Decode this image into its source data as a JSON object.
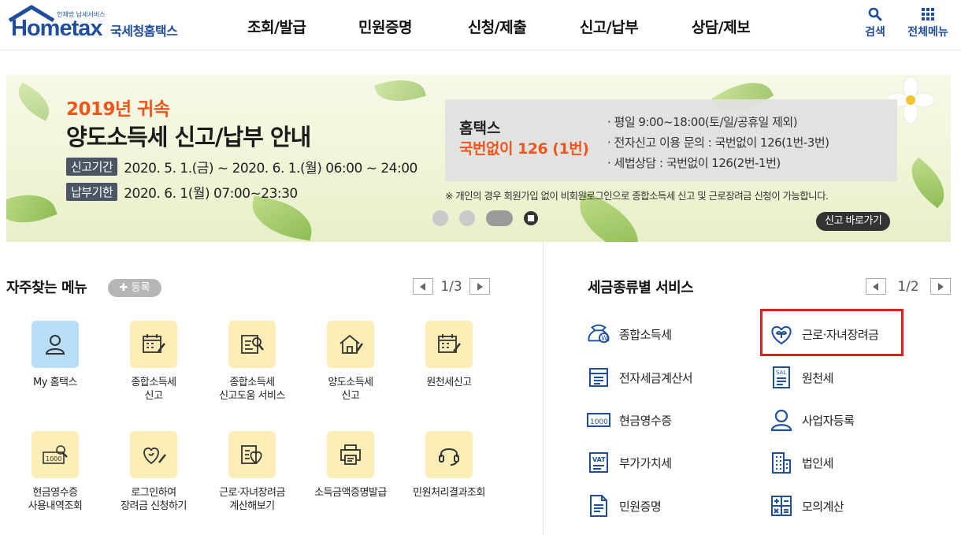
{
  "logo": {
    "small_text": "언제방 납세서비스",
    "brand": "Hometax",
    "brand_kr": "국세청홈택스"
  },
  "gnb": [
    "조회/발급",
    "민원증명",
    "신청/제출",
    "신고/납부",
    "상담/제보"
  ],
  "util": {
    "search": "검색",
    "all_menu": "전체메뉴"
  },
  "banner": {
    "title1": "2019년 귀속",
    "title2": "양도소득세 신고/납부 안내",
    "period1_tag": "신고기간",
    "period1": "2020. 5. 1.(금) ~ 2020. 6. 1.(월) 06:00 ~ 24:00",
    "period2_tag": "납부기한",
    "period2": "2020. 6. 1(월) 07:00~23:30",
    "box_title1": "홈택스",
    "box_title2": "국번없이 126 (1번)",
    "box_lines": [
      "· 평일 9:00~18:00(토/일/공휴일 제외)",
      "· 전자신고 이용 문의 : 국번없이 126(1번-3번)",
      "· 세법상담 : 국번없이 126(2번-1번)"
    ],
    "note": "※ 개인의 경우 회원가입 없이 비회원로그인으로 종합소득세 신고 및 근로장려금 신청이 가능합니다.",
    "button": "신고 바로가기"
  },
  "favorites": {
    "title": "자주찾는 메뉴",
    "add_label": "등록",
    "page": "1/3",
    "items": [
      {
        "label1": "My 홈택스",
        "label2": "",
        "icon": "user-icon"
      },
      {
        "label1": "종합소득세",
        "label2": "신고",
        "icon": "calendar-pen-icon"
      },
      {
        "label1": "종합소득세",
        "label2": "신고도움 서비스",
        "icon": "doc-search-icon"
      },
      {
        "label1": "양도소득세",
        "label2": "신고",
        "icon": "house-pen-icon"
      },
      {
        "label1": "원천세신고",
        "label2": "",
        "icon": "calendar-pen-icon"
      },
      {
        "label1": "현금영수증",
        "label2": "사용내역조회",
        "icon": "receipt-search-icon"
      },
      {
        "label1": "로그인하여",
        "label2": "장려금 신청하기",
        "icon": "heart-pen-icon"
      },
      {
        "label1": "근로·자녀장려금",
        "label2": "계산해보기",
        "icon": "heart-doc-icon"
      },
      {
        "label1": "소득금액증명발급",
        "label2": "",
        "icon": "printer-icon"
      },
      {
        "label1": "민원처리결과조회",
        "label2": "",
        "icon": "headset-icon"
      }
    ]
  },
  "tax_services": {
    "title": "세금종류별 서비스",
    "page": "1/2",
    "items": [
      {
        "label": "종합소득세",
        "icon": "money-bag-icon"
      },
      {
        "label": "근로·자녀장려금",
        "icon": "heart-sprout-icon"
      },
      {
        "label": "전자세금계산서",
        "icon": "invoice-icon"
      },
      {
        "label": "원천세",
        "icon": "sal-doc-icon"
      },
      {
        "label": "현금영수증",
        "icon": "receipt-1000-icon"
      },
      {
        "label": "사업자등록",
        "icon": "person-icon"
      },
      {
        "label": "부가가치세",
        "icon": "vat-icon"
      },
      {
        "label": "법인세",
        "icon": "building-icon"
      },
      {
        "label": "민원증명",
        "icon": "document-icon"
      },
      {
        "label": "모의계산",
        "icon": "calculator-icon"
      }
    ]
  },
  "colors": {
    "brand_blue": "#1f4f9c",
    "accent_orange": "#f0561c",
    "highlight_red": "#e01e1e"
  }
}
